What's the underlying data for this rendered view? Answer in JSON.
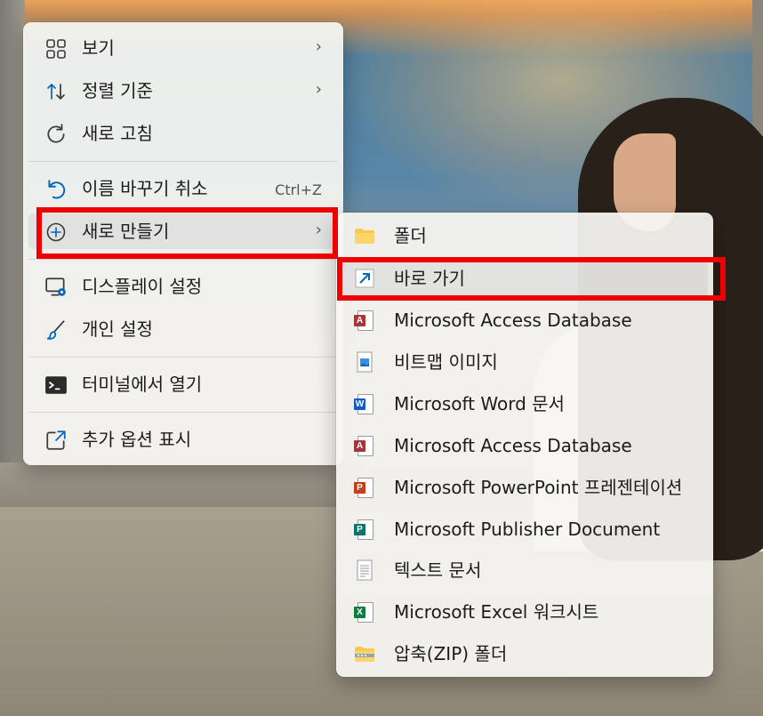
{
  "main_menu": {
    "items": [
      {
        "label": "보기",
        "icon": "view-grid-icon",
        "has_submenu": true
      },
      {
        "label": "정렬 기준",
        "icon": "sort-icon",
        "has_submenu": true
      },
      {
        "label": "새로 고침",
        "icon": "refresh-icon",
        "has_submenu": false
      },
      {
        "label": "이름 바꾸기 취소",
        "icon": "undo-icon",
        "shortcut": "Ctrl+Z"
      },
      {
        "label": "새로 만들기",
        "icon": "new-plus-icon",
        "has_submenu": true
      },
      {
        "label": "디스플레이 설정",
        "icon": "display-settings-icon"
      },
      {
        "label": "개인 설정",
        "icon": "brush-icon"
      },
      {
        "label": "터미널에서 열기",
        "icon": "terminal-icon"
      },
      {
        "label": "추가 옵션 표시",
        "icon": "more-options-icon"
      }
    ],
    "chevron": "›"
  },
  "sub_menu": {
    "items": [
      {
        "label": "폴더",
        "icon": "folder-icon"
      },
      {
        "label": "바로 가기",
        "icon": "shortcut-arrow-icon"
      },
      {
        "label": "Microsoft Access Database",
        "icon": "access-icon"
      },
      {
        "label": "비트맵 이미지",
        "icon": "bitmap-icon"
      },
      {
        "label": "Microsoft Word 문서",
        "icon": "word-icon"
      },
      {
        "label": "Microsoft Access Database",
        "icon": "access-icon"
      },
      {
        "label": "Microsoft PowerPoint 프레젠테이션",
        "icon": "powerpoint-icon"
      },
      {
        "label": "Microsoft Publisher Document",
        "icon": "publisher-icon"
      },
      {
        "label": "텍스트 문서",
        "icon": "text-document-icon"
      },
      {
        "label": "Microsoft Excel 워크시트",
        "icon": "excel-icon"
      },
      {
        "label": "압축(ZIP) 폴더",
        "icon": "zip-folder-icon"
      }
    ]
  },
  "icon_letters": {
    "access": "A",
    "word": "W",
    "powerpoint": "P",
    "publisher": "P",
    "excel": "X"
  },
  "colors": {
    "highlight": "#ee0000",
    "accent": "#0067c0",
    "access": "#a4373a",
    "word": "#185abd",
    "powerpoint": "#c43e1c",
    "publisher": "#077568",
    "excel": "#107c41",
    "folder": "#f8c94a"
  }
}
